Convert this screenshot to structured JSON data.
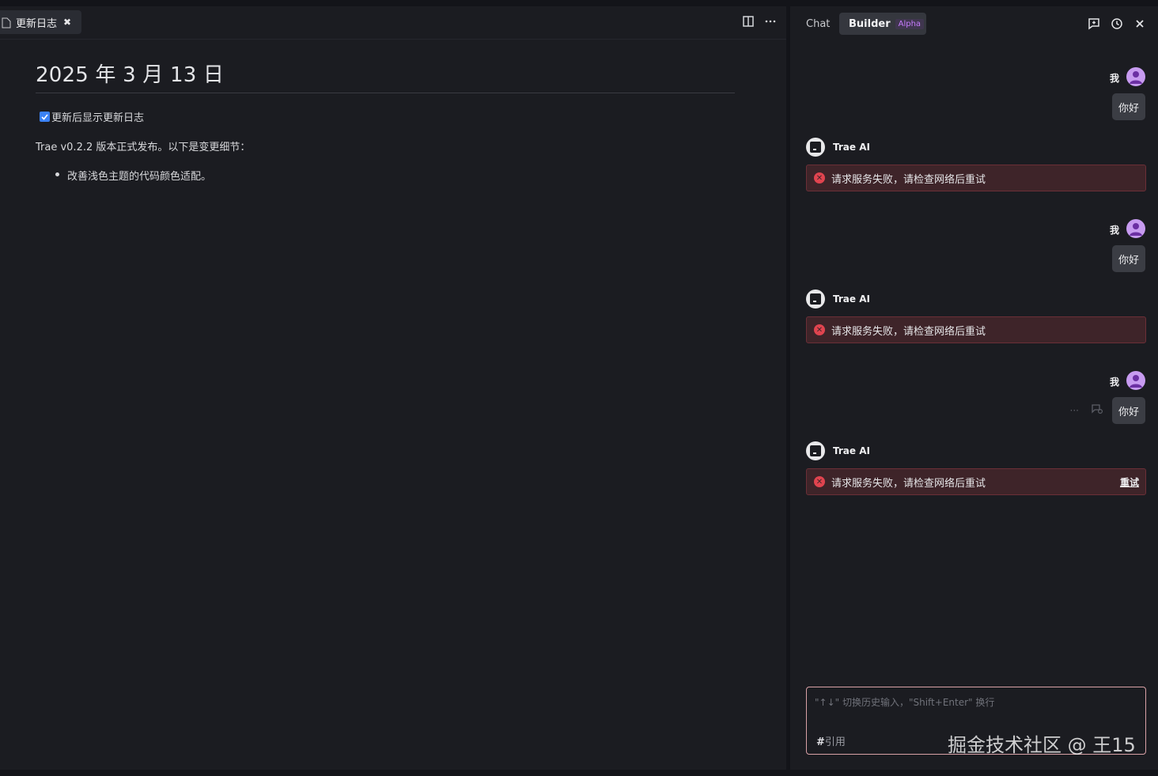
{
  "editor": {
    "tab": {
      "label": "更新日志"
    },
    "doc": {
      "title": "2025 年 3 月 13 日",
      "checkbox_label": "更新后显示更新日志",
      "intro": "Trae v0.2.2 版本正式发布。以下是变更细节：",
      "bullets": [
        "改善浅色主题的代码颜色适配。"
      ]
    }
  },
  "chat": {
    "tabs": {
      "chat": "Chat",
      "builder": "Builder",
      "builder_badge": "Alpha"
    },
    "user_name": "我",
    "ai_name": "Trae AI",
    "messages": [
      {
        "user_text": "你好",
        "error_text": "请求服务失败，请检查网络后重试"
      },
      {
        "user_text": "你好",
        "error_text": "请求服务失败，请检查网络后重试"
      },
      {
        "user_text": "你好",
        "error_text": "请求服务失败，请检查网络后重试",
        "retry_label": "重试"
      }
    ],
    "input": {
      "placeholder": "\"↑↓\" 切换历史输入，\"Shift+Enter\" 换行",
      "cite_label": "引用",
      "cite_hash": "#"
    }
  },
  "watermark": "掘金技术社区 @ 王15"
}
